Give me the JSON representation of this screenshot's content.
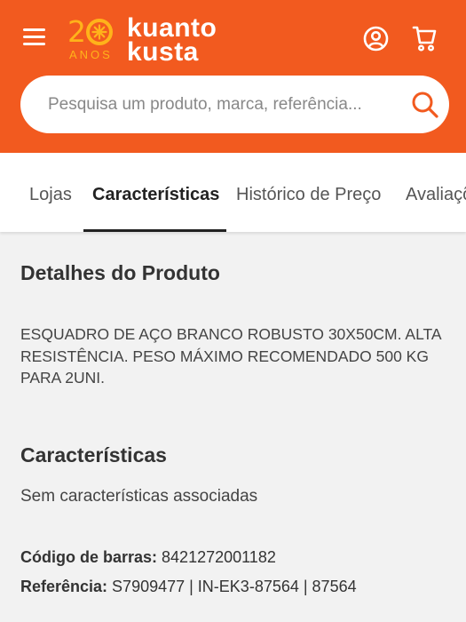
{
  "header": {
    "logo": {
      "anniversary": "20",
      "anos": "ANOS",
      "word1": "kuanto",
      "word2": "kusta"
    },
    "icons": {
      "menu": "hamburger-icon",
      "user": "user-icon",
      "cart": "cart-icon",
      "search": "search-icon"
    },
    "colors": {
      "brand": "#f25a1f",
      "logo_accent": "#ffb31a"
    }
  },
  "search": {
    "placeholder": "Pesquisa um produto, marca, referência..."
  },
  "tabs": [
    {
      "label": "Lojas",
      "active": false
    },
    {
      "label": "Características",
      "active": true
    },
    {
      "label": "Histórico de Preço",
      "active": false
    },
    {
      "label": "Avaliações",
      "active": false
    }
  ],
  "details": {
    "heading": "Detalhes do Produto",
    "description": "ESQUADRO DE AÇO BRANCO ROBUSTO 30X50CM. ALTA RESISTÊNCIA. PESO MÁXIMO RECOMENDADO 500 KG PARA 2UNI."
  },
  "features": {
    "heading": "Características",
    "empty_text": "Sem características associadas",
    "barcode_label": "Código de barras:",
    "barcode_value": "8421272001182",
    "reference_label": "Referência:",
    "reference_value": "S7909477 | IN-EK3-87564 | 87564"
  }
}
